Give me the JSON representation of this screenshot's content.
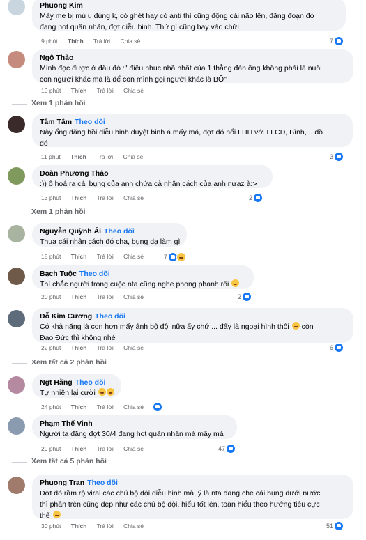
{
  "comments": [
    {
      "name": "Phuong Kim",
      "follow": "",
      "lines": [
        "Mấy me bị mù u đúng k, có ghét hay có anti thì cũng động cái não lên, đăng đoạn đó",
        "đang hot quân nhân, đợt diễu binh. Thứ gì cũng bay vào chửi"
      ],
      "time": "9 phút",
      "like": "Thích",
      "reply": "Trả lời",
      "share": "Chia sẻ",
      "reactions": "7",
      "reaction_types": [
        "like"
      ],
      "avatar_color": "#c9d6df"
    },
    {
      "name": "Ngô Thảo",
      "follow": "",
      "lines": [
        "Mình đọc được ở đâu đó :\" điều nhục nhã nhất của 1 thằng đàn ông không phải là nuôi",
        "con người khác mà là để con mình gọi người khác là BỐ\""
      ],
      "time": "10 phút",
      "like": "Thích",
      "reply": "Trả lời",
      "share": "Chia sẻ",
      "reactions": "",
      "reaction_types": [],
      "avatar_color": "#c58b7d"
    },
    {
      "name": "Tâm Tâm",
      "follow": "Theo dõi",
      "lines": [
        "Này ổng đăng hồi diễu binh duyệt binh á mấy má, đợt đó nổi LHH với LLCD, Bình,... đồ",
        "đó"
      ],
      "time": "11 phút",
      "like": "Thích",
      "reply": "Trả lời",
      "share": "Chia sẻ",
      "reactions": "3",
      "reaction_types": [
        "like"
      ],
      "avatar_color": "#3b2a2a"
    },
    {
      "name": "Đoàn Phương Thảo",
      "follow": "",
      "lines": [
        ":)) ô hoá ra cái bụng của anh chứa cả nhân cách của anh nưaz à:>"
      ],
      "time": "13 phút",
      "like": "Thích",
      "reply": "Trả lời",
      "share": "Chia sẻ",
      "reactions": "2",
      "reaction_types": [
        "like"
      ],
      "avatar_color": "#7f9a5c"
    },
    {
      "name": "Nguyễn Quỳnh Ái",
      "follow": "Theo dõi",
      "lines": [
        "Thua cái nhân cách đó cha, bụng dạ làm gì"
      ],
      "time": "18 phút",
      "like": "Thích",
      "reply": "Trả lời",
      "share": "Chia sẻ",
      "reactions": "7",
      "reaction_types": [
        "like",
        "haha"
      ],
      "avatar_color": "#a8b3a0"
    },
    {
      "name": "Bạch Tuộc",
      "follow": "Theo dõi",
      "lines": [
        "Thì chắc người trong cuộc nta cũng nghe phong phanh rồi"
      ],
      "time": "20 phút",
      "like": "Thích",
      "reply": "Trả lời",
      "share": "Chia sẻ",
      "reactions": "2",
      "reaction_types": [
        "like"
      ],
      "avatar_color": "#6f5a4a"
    },
    {
      "name": "Đỗ Kim Cương",
      "follow": "Theo dõi",
      "lines": [
        "Có khả năng là con hơn mấy ảnh bộ đội nữa ấy chứ ... đấy là ngoại hình thôi",
        "Đạo Đức thì không nhé"
      ],
      "time": "22 phút",
      "like": "Thích",
      "reply": "Trả lời",
      "share": "Chia sẻ",
      "reactions": "6",
      "reaction_types": [
        "like"
      ],
      "avatar_color": "#5d6b7a"
    },
    {
      "name": "Ngt Hằng",
      "follow": "Theo dõi",
      "lines": [
        "Tự nhiên lại cười"
      ],
      "time": "24 phút",
      "like": "Thích",
      "reply": "Trả lời",
      "share": "Chia sẻ",
      "reactions": "",
      "reaction_types": [
        "like"
      ],
      "avatar_color": "#b58aa0"
    },
    {
      "name": "Phạm Thế Vinh",
      "follow": "",
      "lines": [
        "Người ta đăng đợt 30/4 đang hot quân nhân mà mấy má"
      ],
      "time": "29 phút",
      "like": "Thích",
      "reply": "Trả lời",
      "share": "Chia sẻ",
      "reactions": "47",
      "reaction_types": [
        "like"
      ],
      "avatar_color": "#8a9bb0"
    },
    {
      "name": "Phuong Tran",
      "follow": "Theo dõi",
      "lines": [
        "Đợt đó rầm rộ viral các chú bộ đội diễu binh mà, ý là nta đang che cái bụng dưới nước",
        "thì phần trên cũng đẹp như các chú bộ đội, hiểu tốt lên, toàn hiểu theo hướng tiêu cực",
        "thế"
      ],
      "time": "30 phút",
      "like": "Thích",
      "reply": "Trả lời",
      "share": "Chia sẻ",
      "reactions": "51",
      "reaction_types": [
        "like"
      ],
      "avatar_color": "#a07a6a"
    }
  ],
  "view_replies": {
    "one": "Xem 1 phản hồi",
    "one_b": "Xem 1 phản hồi",
    "two": "Xem tất cả 2 phản hồi",
    "five": "Xem tất cả 5 phản hồi"
  }
}
